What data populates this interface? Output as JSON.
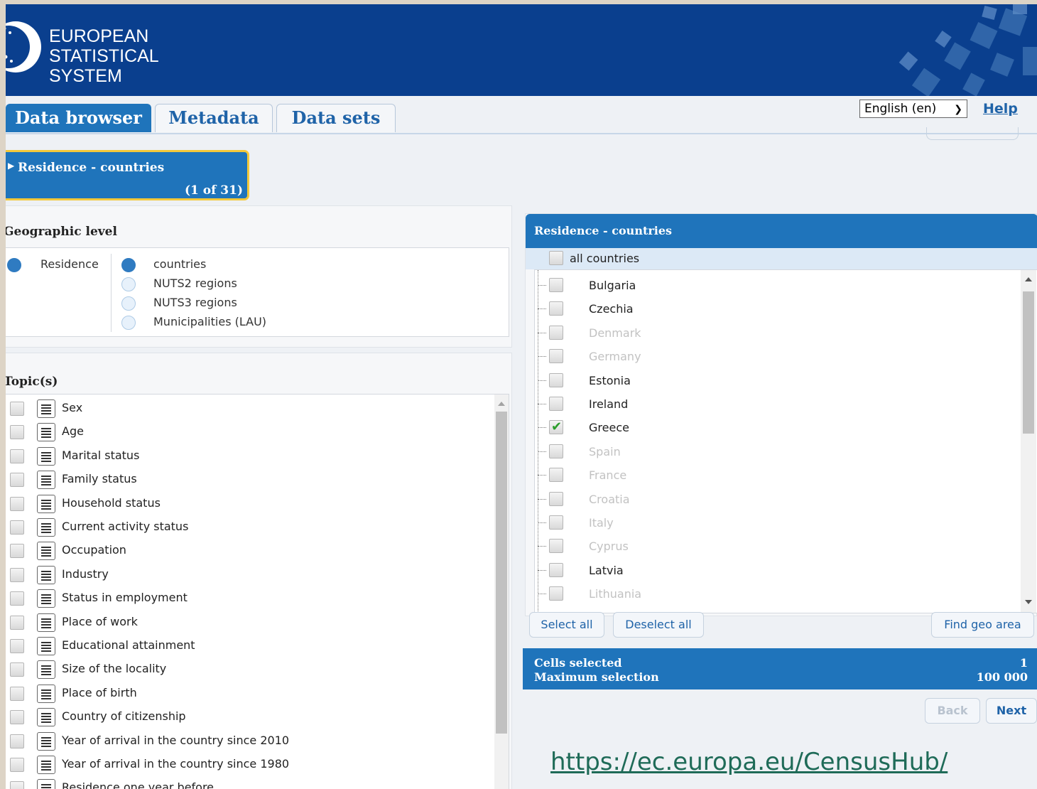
{
  "header": {
    "logo_lines": [
      "EUROPEAN",
      "STATISTICAL",
      "SYSTEM"
    ],
    "brand_color": "#0a3f8e"
  },
  "tabs": [
    {
      "label": "Data browser",
      "active": true
    },
    {
      "label": "Metadata",
      "active": false
    },
    {
      "label": "Data sets",
      "active": false
    }
  ],
  "language": {
    "selected": "English (en)"
  },
  "help_label": "Help",
  "breadcrumb": {
    "title": "Residence - countries",
    "count": "(1 of 31)"
  },
  "geographic_level": {
    "title": "Geographic level",
    "dimension": "Residence",
    "options": [
      {
        "label": "countries",
        "selected": true
      },
      {
        "label": "NUTS2 regions",
        "selected": false
      },
      {
        "label": "NUTS3 regions",
        "selected": false
      },
      {
        "label": "Municipalities (LAU)",
        "selected": false
      }
    ]
  },
  "topics": {
    "title": "Topic(s)",
    "items": [
      "Sex",
      "Age",
      "Marital status",
      "Family status",
      "Household status",
      "Current activity status",
      "Occupation",
      "Industry",
      "Status in employment",
      "Place of work",
      "Educational attainment",
      "Size of the locality",
      "Place of birth",
      "Country of citizenship",
      "Year of arrival in the country since 2010",
      "Year of arrival in the country since 1980",
      "Residence one year before"
    ]
  },
  "countries": {
    "title": "Residence - countries",
    "all_label": "all countries",
    "items": [
      {
        "label": "Bulgaria",
        "enabled": true,
        "checked": false
      },
      {
        "label": "Czechia",
        "enabled": true,
        "checked": false
      },
      {
        "label": "Denmark",
        "enabled": false,
        "checked": false
      },
      {
        "label": "Germany",
        "enabled": false,
        "checked": false
      },
      {
        "label": "Estonia",
        "enabled": true,
        "checked": false
      },
      {
        "label": "Ireland",
        "enabled": true,
        "checked": false
      },
      {
        "label": "Greece",
        "enabled": true,
        "checked": true
      },
      {
        "label": "Spain",
        "enabled": false,
        "checked": false
      },
      {
        "label": "France",
        "enabled": false,
        "checked": false
      },
      {
        "label": "Croatia",
        "enabled": false,
        "checked": false
      },
      {
        "label": "Italy",
        "enabled": false,
        "checked": false
      },
      {
        "label": "Cyprus",
        "enabled": false,
        "checked": false
      },
      {
        "label": "Latvia",
        "enabled": true,
        "checked": false
      },
      {
        "label": "Lithuania",
        "enabled": false,
        "checked": false
      }
    ],
    "buttons": {
      "select_all": "Select all",
      "deselect_all": "Deselect all",
      "find_geo": "Find geo area"
    }
  },
  "summary": {
    "cells_label": "Cells selected",
    "cells_value": "1",
    "max_label": "Maximum selection",
    "max_value": "100 000"
  },
  "nav": {
    "back": "Back",
    "next": "Next"
  },
  "footer_url": "https://ec.europa.eu/CensusHub/"
}
